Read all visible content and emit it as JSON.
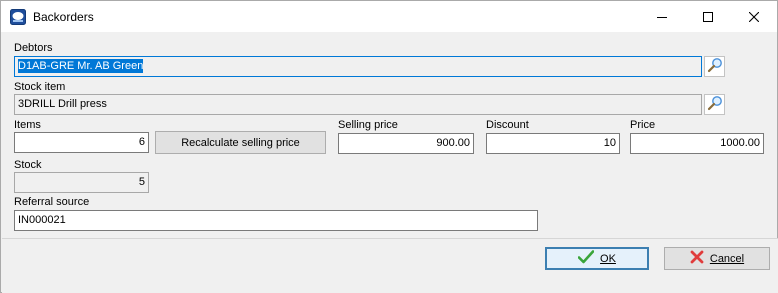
{
  "window": {
    "title": "Backorders",
    "minimize_icon": "minimize-icon",
    "maximize_icon": "maximize-icon",
    "close_icon": "close-icon"
  },
  "form": {
    "debtors": {
      "label": "Debtors",
      "value": "D1AB-GRE Mr. AB Green"
    },
    "stock_item": {
      "label": "Stock item",
      "value": "3DRILL Drill press"
    },
    "items": {
      "label": "Items",
      "value": "6"
    },
    "recalculate_button": "Recalculate selling price",
    "selling_price": {
      "label": "Selling price",
      "value": "900.00"
    },
    "discount": {
      "label": "Discount",
      "value": "10"
    },
    "price": {
      "label": "Price",
      "value": "1000.00"
    },
    "stock": {
      "label": "Stock",
      "value": "5"
    },
    "referral_source": {
      "label": "Referral source",
      "value": "IN000021"
    }
  },
  "footer": {
    "ok_label": "OK",
    "cancel_label": "Cancel"
  },
  "colors": {
    "accent": "#0078d7",
    "ok_check": "#3aa53a",
    "cancel_x": "#e03c3c"
  }
}
